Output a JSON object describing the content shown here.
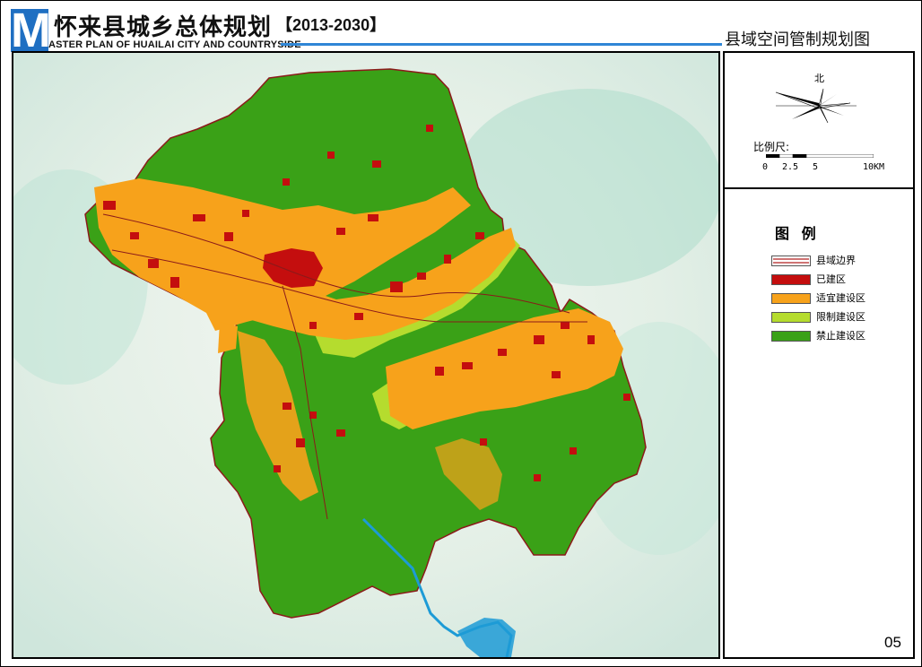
{
  "header": {
    "logo_letter": "M",
    "title_cn": "怀来县城乡总体规划",
    "years": "【2013-2030】",
    "title_en": "ASTER PLAN OF HUAILAI CITY AND COUNTRYSIDE",
    "subtitle": "县域空间管制规划图"
  },
  "compass": {
    "north_label": "北",
    "icon": "compass-rose-icon"
  },
  "scale": {
    "label": "比例尺:",
    "ticks": [
      "0",
      "2.5",
      "5",
      "10KM"
    ]
  },
  "legend": {
    "title": "图 例",
    "items": [
      {
        "label": "县域边界",
        "kind": "line",
        "color": "#b22222"
      },
      {
        "label": "已建区",
        "kind": "fill",
        "color": "#c40e0e"
      },
      {
        "label": "适宜建设区",
        "kind": "fill",
        "color": "#f7a21b"
      },
      {
        "label": "限制建设区",
        "kind": "fill",
        "color": "#b5dc2e"
      },
      {
        "label": "禁止建设区",
        "kind": "fill",
        "color": "#3aa117"
      }
    ]
  },
  "page_number": "05"
}
